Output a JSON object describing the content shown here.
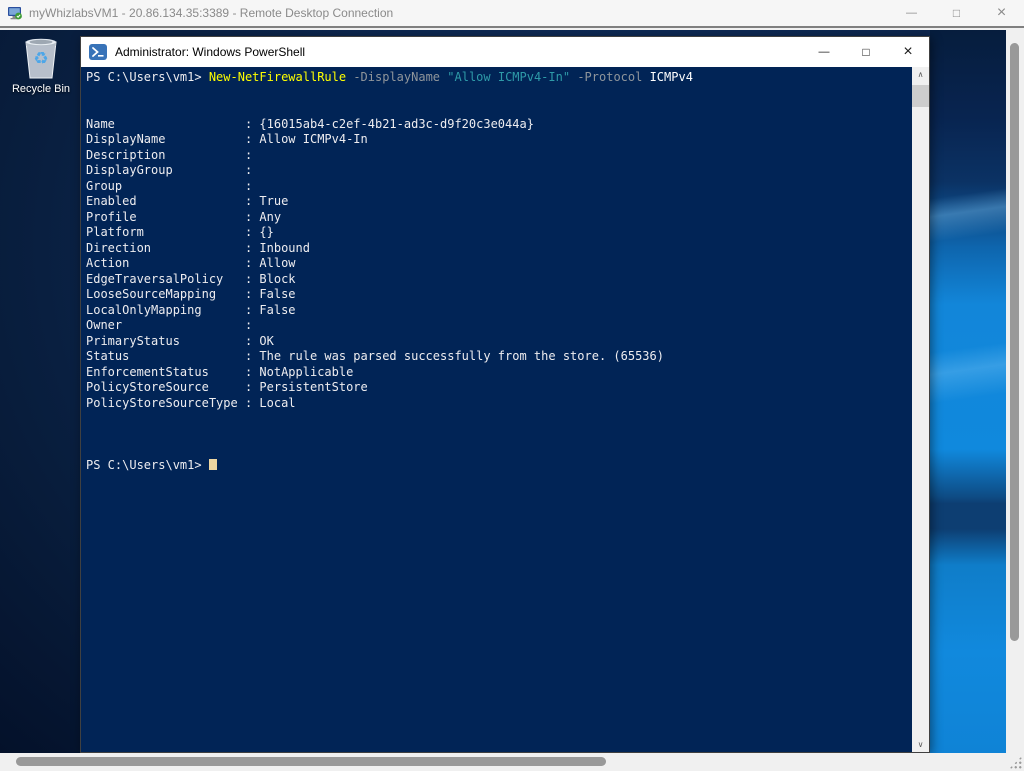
{
  "rdp": {
    "title": "myWhizlabsVM1 - 20.86.134.35:3389 - Remote Desktop Connection",
    "window_controls": {
      "minimize": "—",
      "maximize": "□",
      "close": "×"
    }
  },
  "desktop": {
    "recycle_bin_label": "Recycle Bin",
    "recycle_symbol": "♻"
  },
  "powershell": {
    "title": "Administrator: Windows PowerShell",
    "window_controls": {
      "minimize": "—",
      "maximize": "□",
      "close": "×"
    },
    "scrollbar": {
      "up_arrow": "∧",
      "down_arrow": "∨"
    },
    "colors": {
      "console_background": "#012456",
      "default": "#eeedf0",
      "cmdlet": "#ffff00",
      "parameter": "#8f959b",
      "string": "#2e9aa8",
      "argument": "#ffffff",
      "cursor": "#eed7a1"
    },
    "command_segments": [
      {
        "type": "default",
        "text": "PS C:\\Users\\vm1> "
      },
      {
        "type": "cmdlet",
        "text": "New-NetFirewallRule"
      },
      {
        "type": "parameter",
        "text": " -DisplayName "
      },
      {
        "type": "string",
        "text": "\"Allow ICMPv4-In\""
      },
      {
        "type": "parameter",
        "text": " -Protocol "
      },
      {
        "type": "argument",
        "text": "ICMPv4"
      }
    ],
    "blank_lines_after_command": 2,
    "label_pad": 21,
    "output_fields": [
      {
        "label": "Name",
        "value": "{16015ab4-c2ef-4b21-ad3c-d9f20c3e044a}"
      },
      {
        "label": "DisplayName",
        "value": "Allow ICMPv4-In"
      },
      {
        "label": "Description",
        "value": ""
      },
      {
        "label": "DisplayGroup",
        "value": ""
      },
      {
        "label": "Group",
        "value": ""
      },
      {
        "label": "Enabled",
        "value": "True"
      },
      {
        "label": "Profile",
        "value": "Any"
      },
      {
        "label": "Platform",
        "value": "{}"
      },
      {
        "label": "Direction",
        "value": "Inbound"
      },
      {
        "label": "Action",
        "value": "Allow"
      },
      {
        "label": "EdgeTraversalPolicy",
        "value": "Block"
      },
      {
        "label": "LooseSourceMapping",
        "value": "False"
      },
      {
        "label": "LocalOnlyMapping",
        "value": "False"
      },
      {
        "label": "Owner",
        "value": ""
      },
      {
        "label": "PrimaryStatus",
        "value": "OK"
      },
      {
        "label": "Status",
        "value": "The rule was parsed successfully from the store. (65536)"
      },
      {
        "label": "EnforcementStatus",
        "value": "NotApplicable"
      },
      {
        "label": "PolicyStoreSource",
        "value": "PersistentStore"
      },
      {
        "label": "PolicyStoreSourceType",
        "value": "Local"
      }
    ],
    "blank_lines_after_output": 3,
    "prompt": "PS C:\\Users\\vm1> "
  }
}
